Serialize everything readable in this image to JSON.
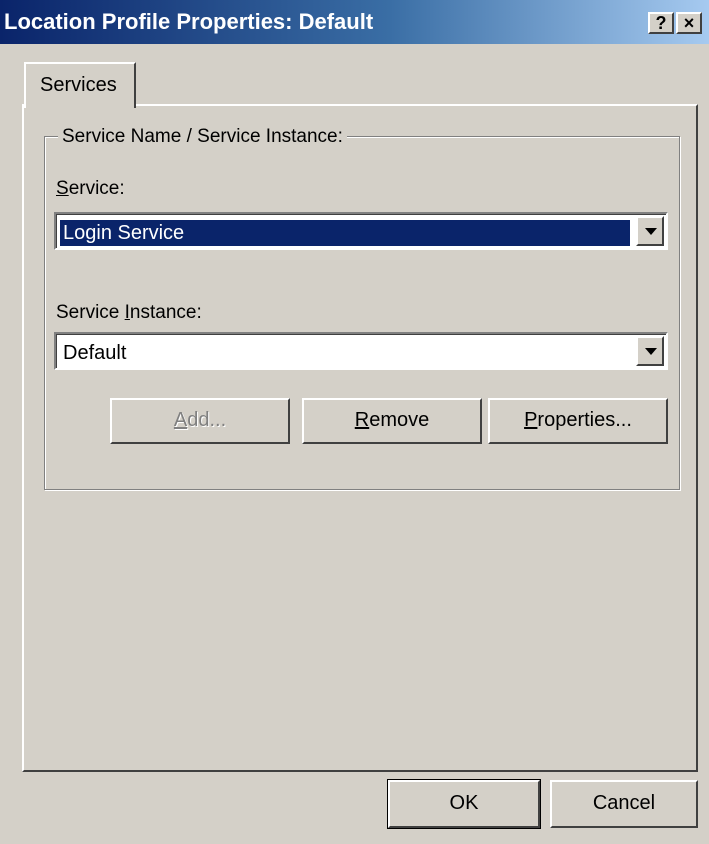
{
  "window": {
    "title": "Location Profile Properties: Default",
    "help_glyph": "?",
    "close_glyph": "×"
  },
  "tabs": [
    {
      "label": "Services",
      "selected": true
    }
  ],
  "group": {
    "legend": "Service Name / Service Instance:"
  },
  "service": {
    "label_pre": "",
    "label_key": "S",
    "label_post": "ervice:",
    "value": "Login Service"
  },
  "instance": {
    "label_pre": "Service ",
    "label_key": "I",
    "label_post": "nstance:",
    "value": "Default"
  },
  "buttons": {
    "add": {
      "key": "A",
      "rest": "dd...",
      "enabled": false
    },
    "remove": {
      "key": "R",
      "rest": "emove",
      "enabled": true
    },
    "properties": {
      "key": "P",
      "rest": "roperties...",
      "enabled": true
    }
  },
  "footer": {
    "ok": "OK",
    "cancel": "Cancel"
  },
  "colors": {
    "face": "#d4d0c8",
    "title_start": "#0a246a",
    "selection": "#0a246a"
  }
}
